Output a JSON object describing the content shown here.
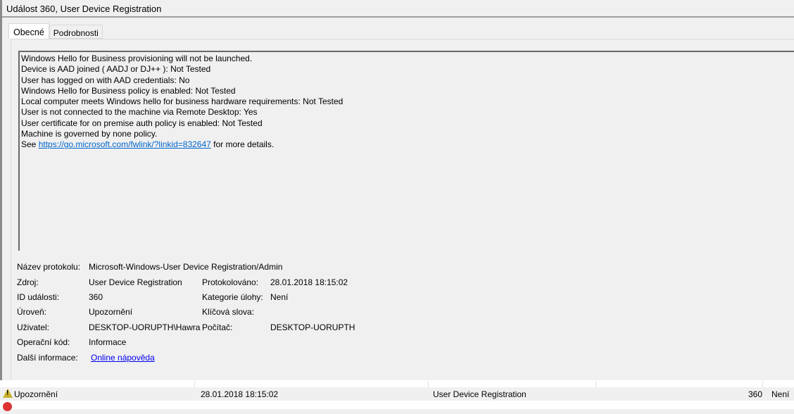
{
  "window": {
    "title": "Událost 360, User Device Registration"
  },
  "tabs": [
    {
      "label": "Obecné",
      "active": true
    },
    {
      "label": "Podrobnosti",
      "active": false
    }
  ],
  "description": {
    "lines": [
      "Windows Hello for Business provisioning will not be launched.",
      "Device is AAD joined ( AADJ or DJ++ ): Not Tested",
      "User has logged on with AAD credentials: No",
      "Windows Hello for Business policy is enabled: Not Tested",
      "Local computer meets Windows hello for business hardware requirements: Not Tested",
      "User is not connected to the machine via Remote Desktop: Yes",
      "User certificate for on premise auth policy is enabled: Not Tested",
      "Machine is governed by none policy."
    ],
    "see_prefix": "See ",
    "link": "https://go.microsoft.com/fwlink/?linkid=832647",
    "see_suffix": " for more details."
  },
  "properties": {
    "log_name_label": "Název protokolu:",
    "log_name": "Microsoft-Windows-User Device Registration/Admin",
    "source_label": "Zdroj:",
    "source": "User Device Registration",
    "logged_label": "Protokolováno:",
    "logged": "28.01.2018 18:15:02",
    "event_id_label": "ID události:",
    "event_id": "360",
    "task_label": "Kategorie úlohy:",
    "task": "Není",
    "level_label": "Úroveň:",
    "level": "Upozornění",
    "keywords_label": "Klíčová slova:",
    "keywords": "",
    "user_label": "Uživatel:",
    "user": "DESKTOP-UORUPTH\\Hawra",
    "computer_label": "Počítač:",
    "computer": "DESKTOP-UORUPTH",
    "opcode_label": "Operační kód:",
    "opcode": "Informace",
    "more_label": "Další informace:",
    "more_link": "Online nápověda"
  },
  "event_list": {
    "rows": [
      {
        "level": "Upozornění",
        "icon": "warning-icon",
        "date": "28.01.2018 18:15:02",
        "source": "User Device Registration",
        "id": "360",
        "task": "Není",
        "selected": true
      }
    ]
  },
  "colors": {
    "link": "#0066cc",
    "warning": "#c8b22a",
    "error": "#dd3333"
  }
}
